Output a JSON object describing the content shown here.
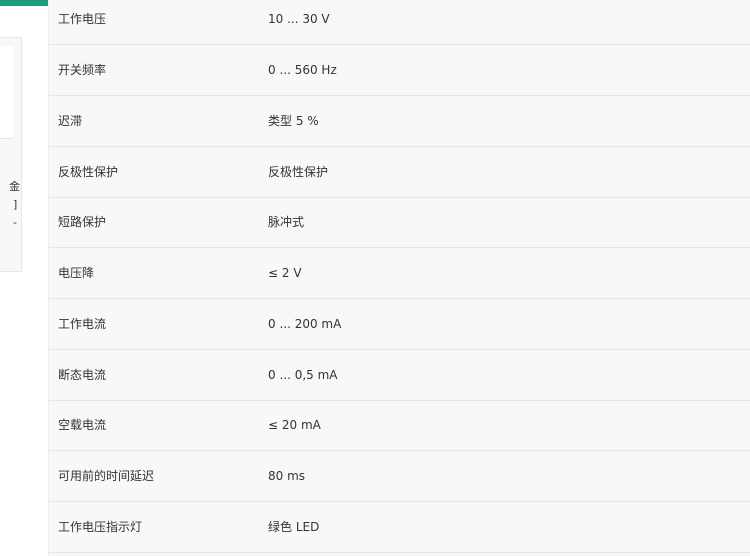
{
  "spec_table": {
    "rows": [
      {
        "label": "工作电压",
        "value": "10 ... 30 V"
      },
      {
        "label": "开关频率",
        "value": "0 ... 560 Hz"
      },
      {
        "label": "迟滞",
        "value": "类型 5 %"
      },
      {
        "label": "反极性保护",
        "value": "反极性保护"
      },
      {
        "label": "短路保护",
        "value": "脉冲式"
      },
      {
        "label": "电压降",
        "value": "≤ 2 V"
      },
      {
        "label": "工作电流",
        "value": "0 ... 200 mA"
      },
      {
        "label": "断态电流",
        "value": "0 ... 0,5 mA"
      },
      {
        "label": "空载电流",
        "value": "≤ 20 mA"
      },
      {
        "label": "可用前的时间延迟",
        "value": "80 ms"
      },
      {
        "label": "工作电压指示灯",
        "value": "绿色 LED"
      }
    ]
  },
  "side_panel": {
    "fragments": [
      "金",
      "]",
      "-"
    ]
  },
  "colors": {
    "accent": "#1d9a78",
    "table_bg": "#f7f8f8",
    "divider": "#e5e7e7",
    "text": "#333333"
  }
}
